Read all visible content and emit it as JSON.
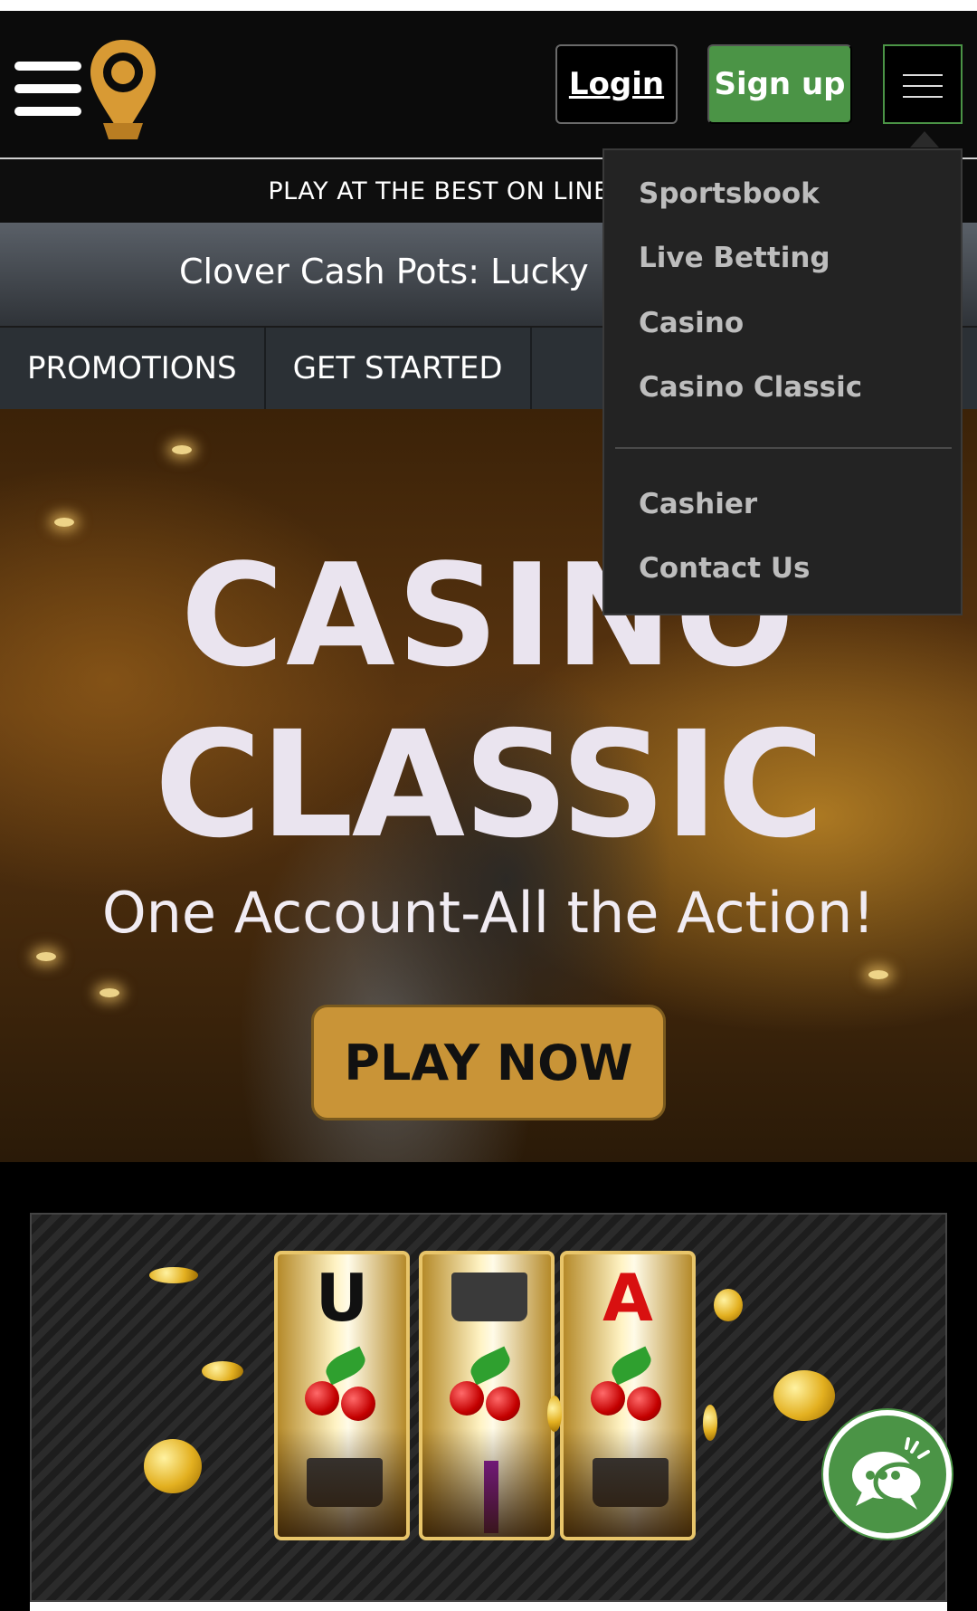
{
  "header": {
    "login_label": "Login",
    "signup_label": "Sign up"
  },
  "tagline": "PLAY AT THE BEST ON LINE",
  "ticker": "Clover Cash Pots: Lucky Fli",
  "subnav": [
    {
      "label": "PROMOTIONS"
    },
    {
      "label": "GET STARTED"
    }
  ],
  "dropdown": {
    "group1": [
      {
        "label": "Sportsbook"
      },
      {
        "label": "Live Betting"
      },
      {
        "label": "Casino"
      },
      {
        "label": "Casino Classic"
      }
    ],
    "group2": [
      {
        "label": "Cashier"
      },
      {
        "label": "Contact Us"
      }
    ]
  },
  "hero": {
    "title_line1": "CASINO",
    "title_line2": "CLASSIC",
    "subtitle": "One Account-All the Action!",
    "cta_label": "PLAY NOW"
  },
  "slot_banner": {
    "reel_letters": [
      "U",
      "",
      "A"
    ]
  },
  "icons": {
    "menu": "hamburger-icon",
    "logo": "location-pin-logo-icon",
    "chat": "chat-bubbles-icon"
  },
  "colors": {
    "accent_green": "#4b9446",
    "gold": "#c99437",
    "header_bg": "#0b0b0b",
    "menu_bg": "#232323"
  }
}
